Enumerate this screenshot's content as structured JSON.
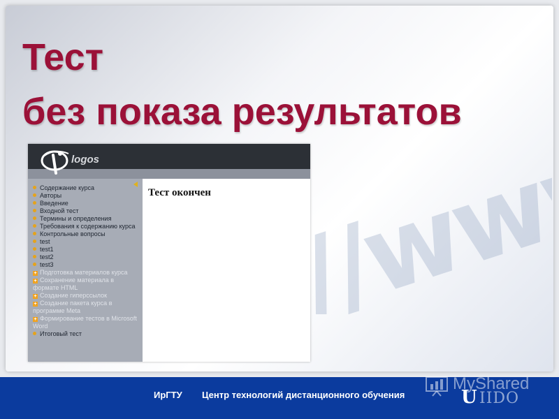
{
  "slide": {
    "title_line1": "Тест",
    "title_line2": "без показа результатов",
    "title_color": "#9b1138",
    "decoration": "//www"
  },
  "app": {
    "logo_text": "logos",
    "nav_items": [
      {
        "label": "Содержание курса",
        "icon": "bullet",
        "enabled": true
      },
      {
        "label": "Авторы",
        "icon": "bullet",
        "enabled": true
      },
      {
        "label": "Введение",
        "icon": "bullet",
        "enabled": true
      },
      {
        "label": "Входной тест",
        "icon": "bullet",
        "enabled": true
      },
      {
        "label": "Термины и определения",
        "icon": "bullet",
        "enabled": true
      },
      {
        "label": "Требования к содержанию курса",
        "icon": "bullet",
        "enabled": true
      },
      {
        "label": "Контрольные вопросы",
        "icon": "bullet",
        "enabled": true
      },
      {
        "label": "test",
        "icon": "bullet",
        "enabled": true
      },
      {
        "label": "test1",
        "icon": "bullet",
        "enabled": true
      },
      {
        "label": "test2",
        "icon": "bullet",
        "enabled": true
      },
      {
        "label": "test3",
        "icon": "bullet",
        "enabled": true
      },
      {
        "label": "Подготовка материалов курса",
        "icon": "plus",
        "enabled": false
      },
      {
        "label": "Сохранение материала в формате HTML",
        "icon": "plus",
        "enabled": false
      },
      {
        "label": "Создание гиперссылок",
        "icon": "plus",
        "enabled": false
      },
      {
        "label": "Создание пакета курса в программе Meta",
        "icon": "plus",
        "enabled": false
      },
      {
        "label": "Формирование тестов в Microsoft Word",
        "icon": "plus",
        "enabled": false
      },
      {
        "label": "Итоговый тест",
        "icon": "bullet",
        "enabled": true
      }
    ],
    "content_heading": "Тест окончен"
  },
  "footer": {
    "org": "ИрГТУ",
    "center": "Центр технологий дистанционного обучения",
    "logo_letter": "U",
    "logo_word": "IIDO",
    "background_color": "#0b3b9e"
  },
  "watermark": {
    "text": "MyShared"
  },
  "icons": {
    "sidebar_collapse": "triangle-left-icon",
    "nav_bullet": "orange-dot-icon",
    "nav_expand": "plus-square-icon",
    "watermark": "presentation-board-icon"
  }
}
